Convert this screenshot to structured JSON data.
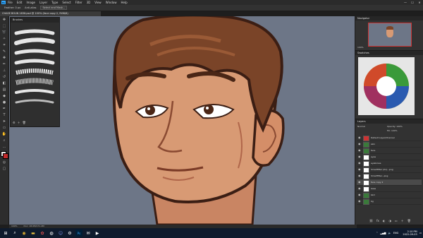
{
  "menubar": {
    "logo": "Ps",
    "items": [
      "File",
      "Edit",
      "Image",
      "Layer",
      "Type",
      "Select",
      "Filter",
      "3D",
      "View",
      "Window",
      "Help"
    ]
  },
  "window_controls": [
    "—",
    "☐",
    "✕"
  ],
  "options_bar": {
    "items": [
      "Feather: 0 px",
      "Anti-alias",
      "Select and Mask..."
    ]
  },
  "document_tab": {
    "title": "CHASE BOUN 1836.psd @ 100% (face copy 2, RGB/8)"
  },
  "brushes_panel": {
    "title": "Brushes"
  },
  "navigator_panel": {
    "title": "Navigator",
    "zoom": "100%"
  },
  "swatches_panel": {
    "title": "Swatches"
  },
  "layers_panel": {
    "title": "Layers",
    "blend_mode": "Normal",
    "opacity": "Opacity: 100%",
    "fill": "Fill: 100%",
    "layers": [
      {
        "name": "Default Layer/Channel",
        "visible": true
      },
      {
        "name": "skin",
        "visible": true
      },
      {
        "name": "face",
        "visible": true
      },
      {
        "name": "eyes",
        "visible": true
      },
      {
        "name": "eyebrows",
        "visible": true
      },
      {
        "name": "Smartfilter (2x)...png",
        "visible": true
      },
      {
        "name": "Smartfilter...png",
        "visible": true
      },
      {
        "name": "face copy 2",
        "visible": true,
        "selected": true
      },
      {
        "name": "base",
        "visible": true
      },
      {
        "name": "bkd",
        "visible": true
      },
      {
        "name": "bg",
        "visible": true
      }
    ]
  },
  "status_bar": {
    "zoom": "100%",
    "doc": "Doc: 18.0M/171.4M"
  },
  "taskbar": {
    "apps": [
      "start-icon",
      "search-icon",
      "chrome-icon",
      "folder-icon",
      "paint-icon",
      "steam-icon",
      "discord-icon",
      "settings-icon",
      "photoshop-icon",
      "mail-icon",
      "media-icon"
    ],
    "tray": {
      "lang": "ENG",
      "time": "2:10 PM",
      "date": "2022-09-03"
    }
  },
  "colors": {
    "canvas_bg": "#6d7687",
    "panel_bg": "#323232",
    "accent": "#31a8ff"
  }
}
